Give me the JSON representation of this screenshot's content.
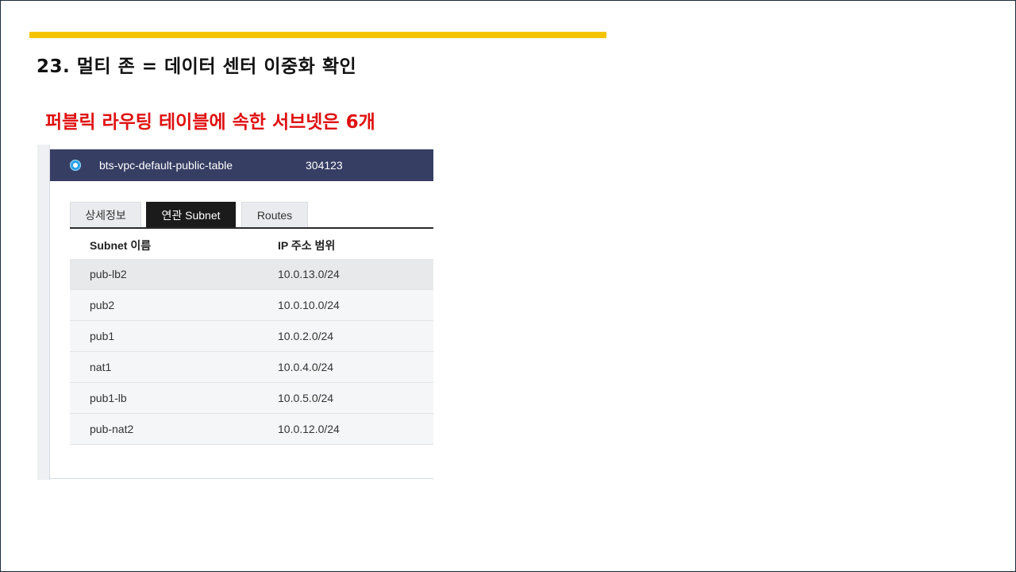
{
  "slide": {
    "title": "23. 멀티 존 = 데이터 센터 이중화 확인",
    "subtitle": "퍼블릭 라우팅 테이블에 속한 서브넷은 6개",
    "colors": {
      "accent": "#f5c400",
      "subtitle": "#e01010",
      "header_bg": "#363e63",
      "radio": "#29a3e6"
    }
  },
  "route_table": {
    "name": "bts-vpc-default-public-table",
    "id": "304123",
    "selected": true
  },
  "tabs": [
    {
      "label": "상세정보",
      "active": false
    },
    {
      "label": "연관 Subnet",
      "active": true
    },
    {
      "label": "Routes",
      "active": false
    }
  ],
  "subnet_table": {
    "columns": [
      "Subnet 이름",
      "IP 주소 범위"
    ],
    "rows": [
      {
        "name": "pub-lb2",
        "cidr": "10.0.13.0/24"
      },
      {
        "name": "pub2",
        "cidr": "10.0.10.0/24"
      },
      {
        "name": "pub1",
        "cidr": "10.0.2.0/24"
      },
      {
        "name": "nat1",
        "cidr": "10.0.4.0/24"
      },
      {
        "name": "pub1-lb",
        "cidr": "10.0.5.0/24"
      },
      {
        "name": "pub-nat2",
        "cidr": "10.0.12.0/24"
      }
    ]
  }
}
